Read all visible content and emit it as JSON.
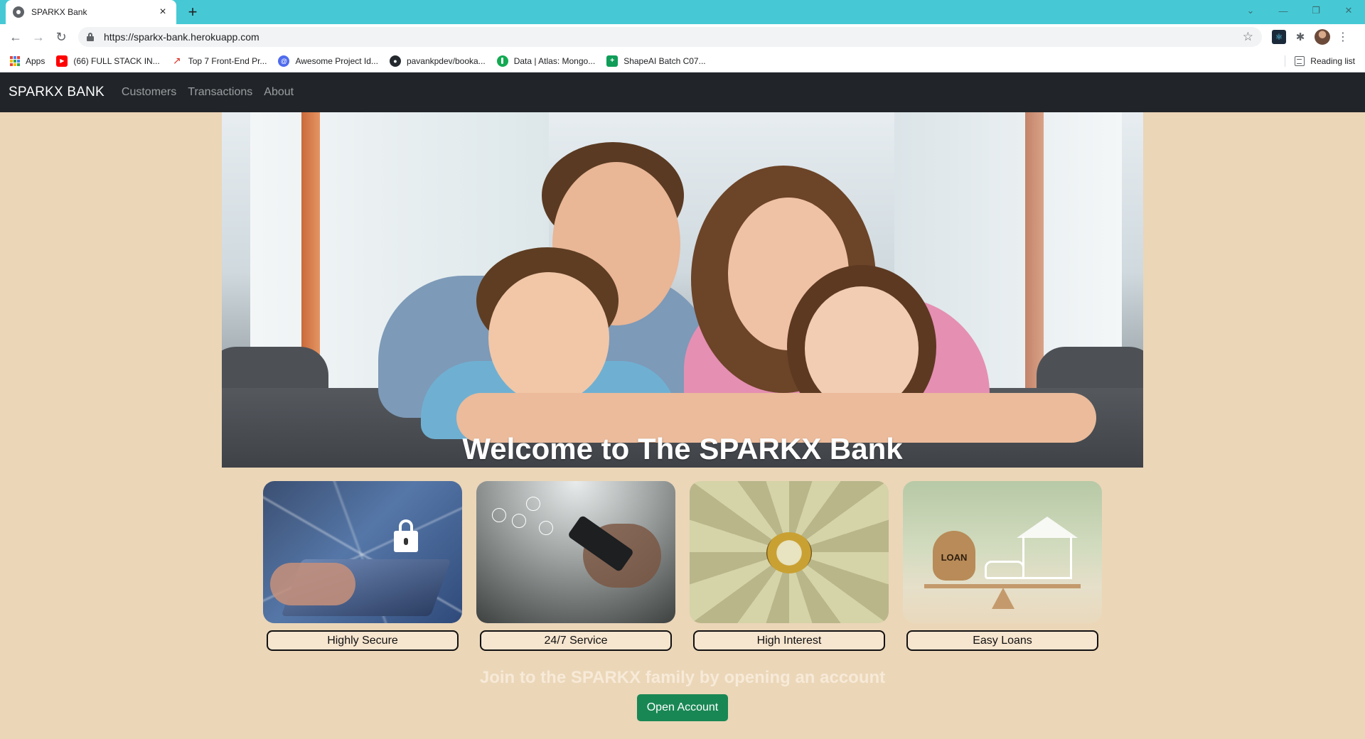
{
  "browser": {
    "tab_title": "SPARKX Bank",
    "url": "https://sparkx-bank.herokuapp.com",
    "bookmarks": [
      {
        "label": "Apps",
        "icon": "apps-grid-icon"
      },
      {
        "label": "(66) FULL STACK IN...",
        "icon": "youtube-icon"
      },
      {
        "label": "Top 7 Front-End Pr...",
        "icon": "arrow-icon"
      },
      {
        "label": "Awesome Project Id...",
        "icon": "globe-icon"
      },
      {
        "label": "pavankpdev/booka...",
        "icon": "github-icon"
      },
      {
        "label": "Data | Atlas: Mongo...",
        "icon": "mongodb-icon"
      },
      {
        "label": "ShapeAI Batch C07...",
        "icon": "shapeai-icon"
      }
    ],
    "reading_list": "Reading list"
  },
  "navbar": {
    "brand": "SPARKX BANK",
    "links": [
      "Customers",
      "Transactions",
      "About"
    ]
  },
  "hero": {
    "title": "Welcome to The SPARKX Bank"
  },
  "features": [
    {
      "label": "Highly Secure"
    },
    {
      "label": "24/7 Service"
    },
    {
      "label": "High Interest"
    },
    {
      "label": "Easy Loans"
    }
  ],
  "loan_bag_text": "LOAN",
  "cta": {
    "text": "Join to the SPARKX family by opening an account",
    "button": "Open Account",
    "button_color": "#198754"
  },
  "colors": {
    "tabstrip": "#46c9d5",
    "navbar": "#212529",
    "page_background": "#ebd6b8"
  }
}
